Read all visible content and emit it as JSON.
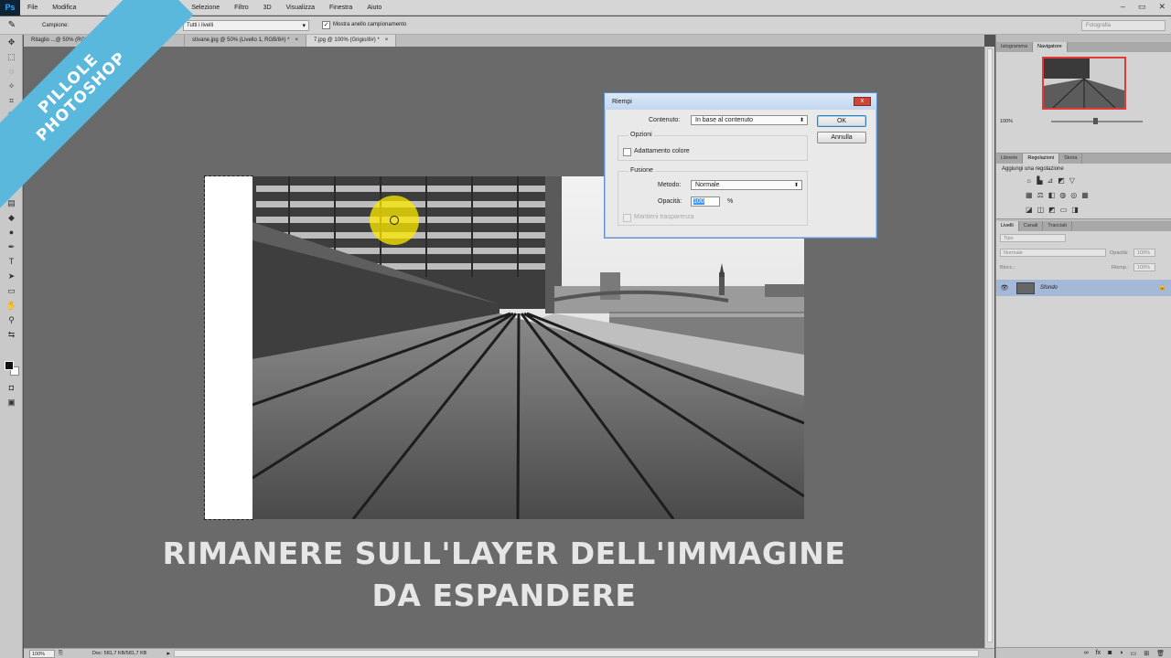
{
  "menu": {
    "items": [
      "File",
      "Modifica",
      "Selezione",
      "Filtro",
      "3D",
      "Visualizza",
      "Finestra",
      "Aiuto"
    ],
    "app_logo": "Ps"
  },
  "options_bar": {
    "sample_label": "Campione:",
    "sample_select": "Tutti i livelli",
    "show_ring_label": "Mostra anello campionamento",
    "workspace": "Fotografia"
  },
  "document_tabs": [
    {
      "label": "Ritaglio ...@ 50% (RGB/8)",
      "close": "×"
    },
    {
      "label": "stivane.jpg @ 50% (Livello 1, RGB/8#) *",
      "close": "×"
    },
    {
      "label": "7.jpg @ 100% (Grigio/8#) *",
      "close": "×"
    }
  ],
  "badge": {
    "line1": "PILLOLE",
    "line2": "PHOTOSHOP"
  },
  "caption": {
    "line1": "RIMANERE SULL'LAYER DELL'IMMAGINE",
    "line2": "DA ESPANDERE"
  },
  "status_bar": {
    "zoom": "100%",
    "doc_info": "Doc: 581,7 KB/581,7 KB"
  },
  "dialog": {
    "title": "Riempi",
    "close": "x",
    "content_label": "Contenuto:",
    "content_value": "In base al contenuto",
    "ok": "OK",
    "cancel": "Annulla",
    "options_label": "Opzioni",
    "color_adapt_label": "Adattamento colore",
    "blend_label": "Fusione",
    "method_label": "Metodo:",
    "method_value": "Normale",
    "opacity_label": "Opacità:",
    "opacity_value": "100",
    "opacity_unit": "%",
    "preserve_label": "Mantieni trasparenza"
  },
  "panels": {
    "top_tabs": [
      "Istogramma",
      "Navigatore"
    ],
    "nav_zoom": "100%",
    "mid_tabs": [
      "Librerie",
      "Regolazioni",
      "Storia"
    ],
    "adjust_label": "Aggiungi una regolazione",
    "layer_tabs": [
      "Livelli",
      "Canali",
      "Tracciati"
    ],
    "filter_label": "Tipo",
    "blend_mode": "Normale",
    "opacity_label": "Opacità:",
    "opacity_value": "100%",
    "lock_label": "Blocc.:",
    "fill_label": "Riemp.:",
    "fill_value": "100%",
    "layer_name": "Sfondo"
  },
  "colors": {
    "badge": "#5ab8dd",
    "highlight": "#ffeb00",
    "caption": "#e6e6e6",
    "layer_selected": "#a4b8d8"
  }
}
